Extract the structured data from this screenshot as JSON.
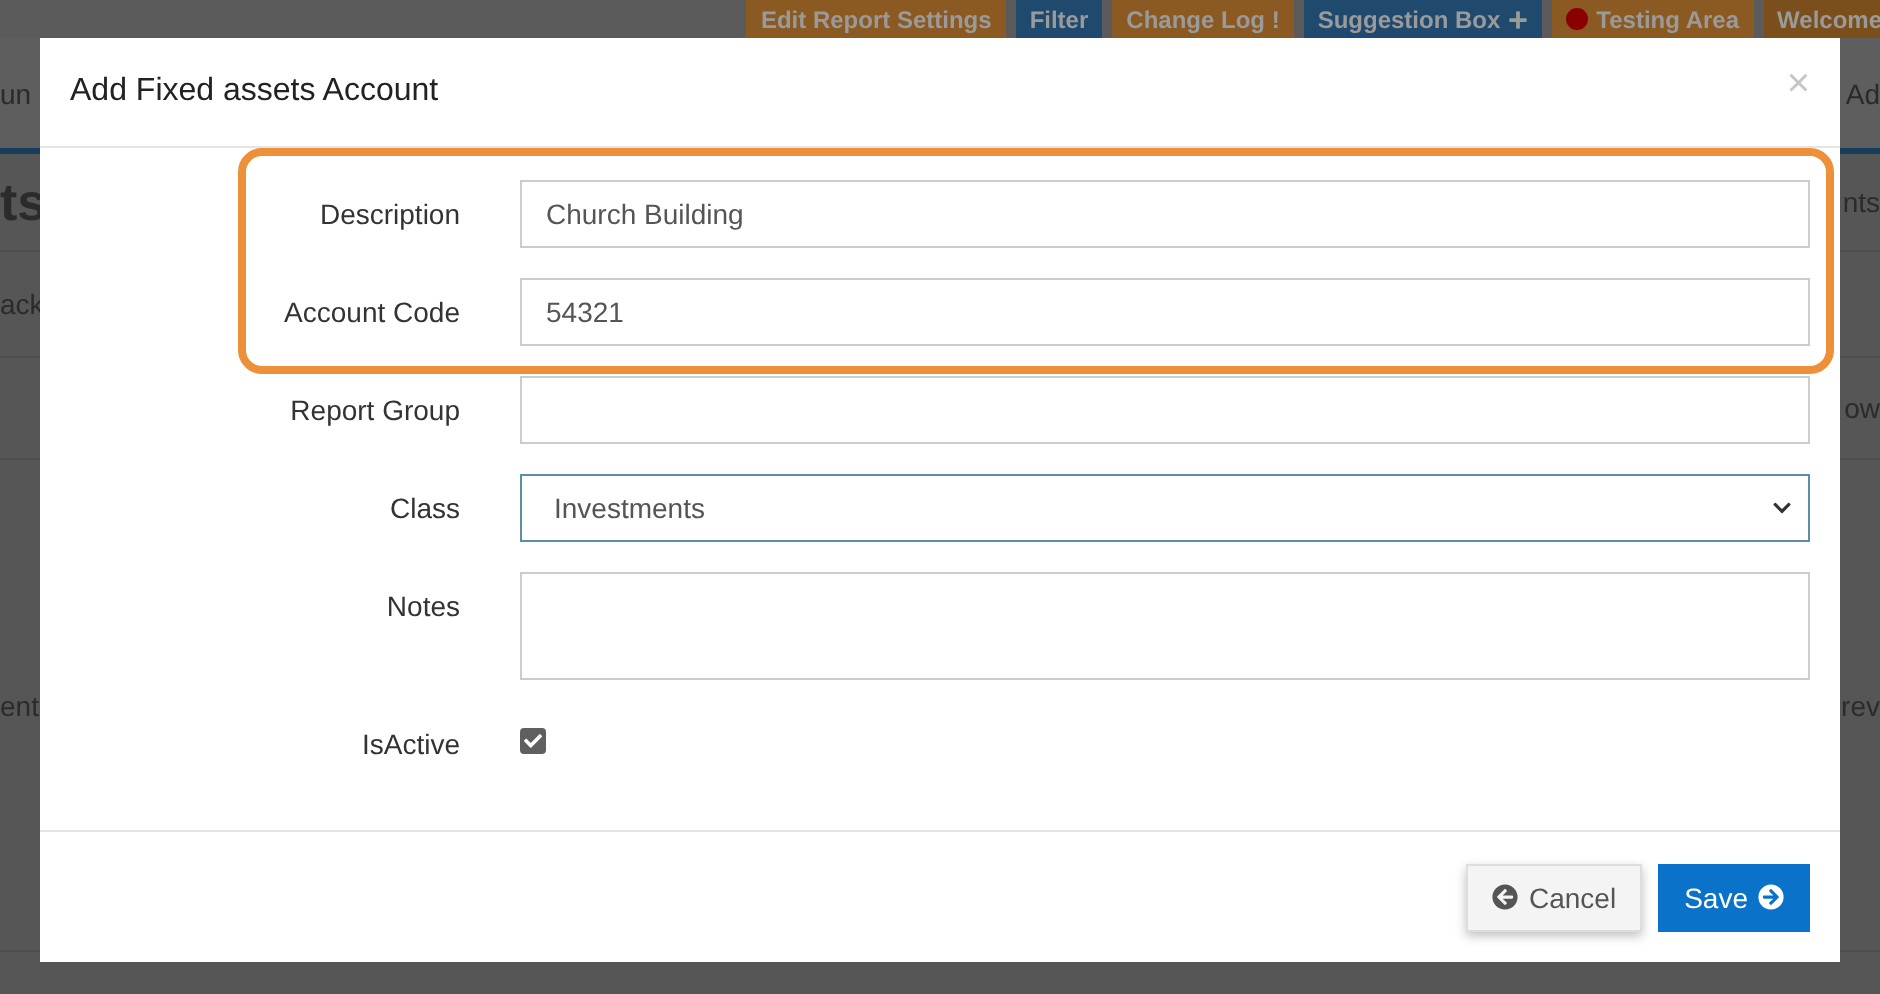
{
  "background": {
    "top_buttons": [
      {
        "label": "Edit Report Settings",
        "color": "#8b5a22",
        "kind": "plain"
      },
      {
        "label": "Filter",
        "color": "#1f4a6e",
        "kind": "plain"
      },
      {
        "label": "Change Log !",
        "color": "#8b5a22",
        "kind": "plain"
      },
      {
        "label": "Suggestion Box",
        "color": "#1f4a6e",
        "kind": "plus"
      },
      {
        "label": "Testing Area",
        "color": "#8b5a22",
        "kind": "dot"
      },
      {
        "label": "Welcome",
        "color": "#7a4f1c",
        "kind": "plain"
      }
    ],
    "fragments": [
      {
        "left": "un",
        "right": "Ad"
      },
      {
        "left": "ts",
        "right": "nts"
      },
      {
        "left": "ack"
      },
      {
        "right": "ow"
      },
      {
        "left": "ent",
        "right": "rev"
      }
    ]
  },
  "modal": {
    "title": "Add Fixed assets Account",
    "close": "×",
    "fields": [
      {
        "label": "Description",
        "kind": "text",
        "value": "Church Building",
        "highlighted": true
      },
      {
        "label": "Account Code",
        "kind": "text",
        "value": "54321",
        "highlighted": true
      },
      {
        "label": "Report Group",
        "kind": "text",
        "highlighted": false
      },
      {
        "label": "Class",
        "kind": "select",
        "value": "Investments",
        "highlighted": false
      },
      {
        "label": "Notes",
        "kind": "textarea",
        "highlighted": false
      },
      {
        "label": "IsActive",
        "kind": "checkbox",
        "checked": true,
        "highlighted": false
      }
    ],
    "buttons": [
      {
        "label": "Cancel",
        "kind": "cancel"
      },
      {
        "label": "Save",
        "kind": "save"
      }
    ]
  }
}
